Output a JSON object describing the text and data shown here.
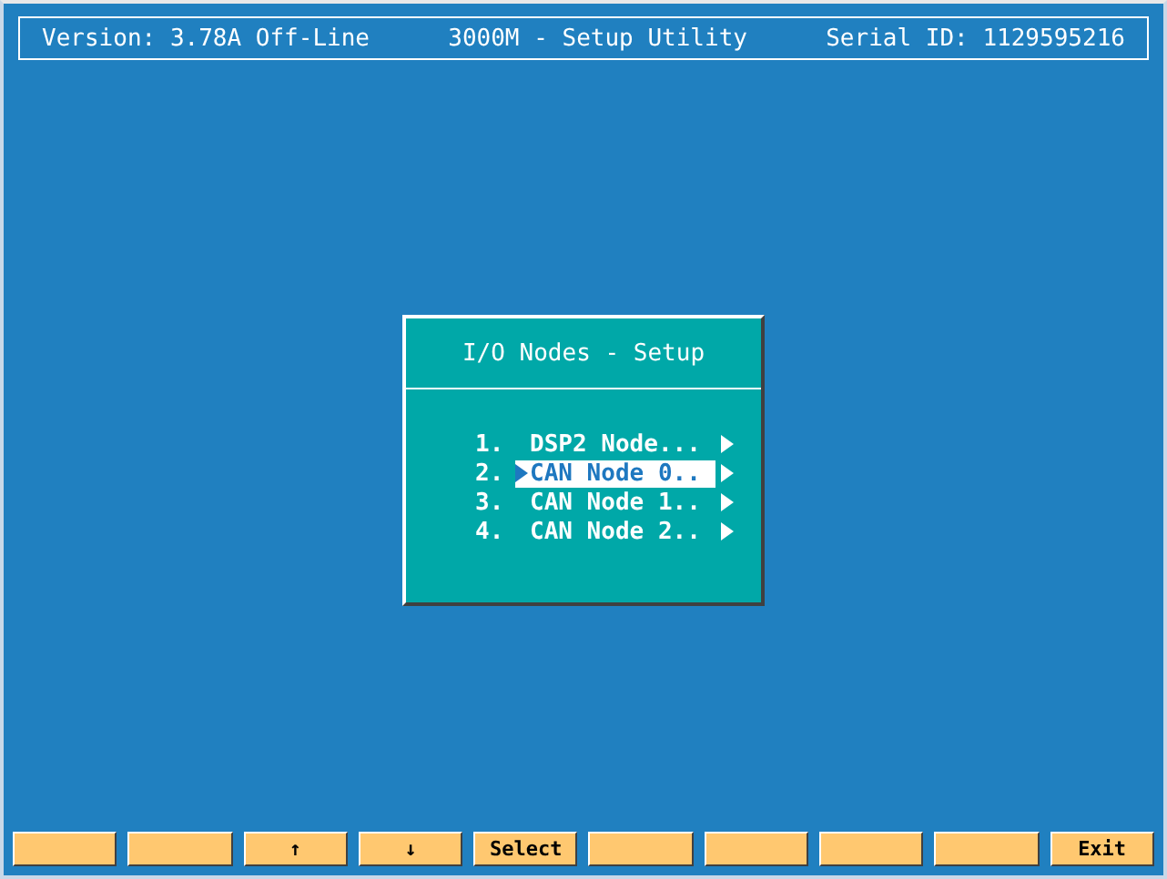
{
  "header": {
    "version": "Version: 3.78A Off-Line",
    "title": "3000M - Setup Utility",
    "serial": "Serial ID: 1129595216"
  },
  "dialog": {
    "title": "I/O Nodes - Setup",
    "items": [
      {
        "number": "1.",
        "label": "DSP2 Node...",
        "selected": false
      },
      {
        "number": "2.",
        "label": "CAN Node 0..",
        "selected": true
      },
      {
        "number": "3.",
        "label": "CAN Node 1..",
        "selected": false
      },
      {
        "number": "4.",
        "label": "CAN Node 2..",
        "selected": false
      }
    ]
  },
  "function_keys": [
    {
      "kind": "blank"
    },
    {
      "kind": "blank"
    },
    {
      "kind": "labeled",
      "label": "↑"
    },
    {
      "kind": "labeled",
      "label": "↓"
    },
    {
      "kind": "labeled",
      "label": "Select"
    },
    {
      "kind": "blank"
    },
    {
      "kind": "blank"
    },
    {
      "kind": "blank"
    },
    {
      "kind": "blank"
    },
    {
      "kind": "labeled",
      "label": "Exit"
    }
  ]
}
